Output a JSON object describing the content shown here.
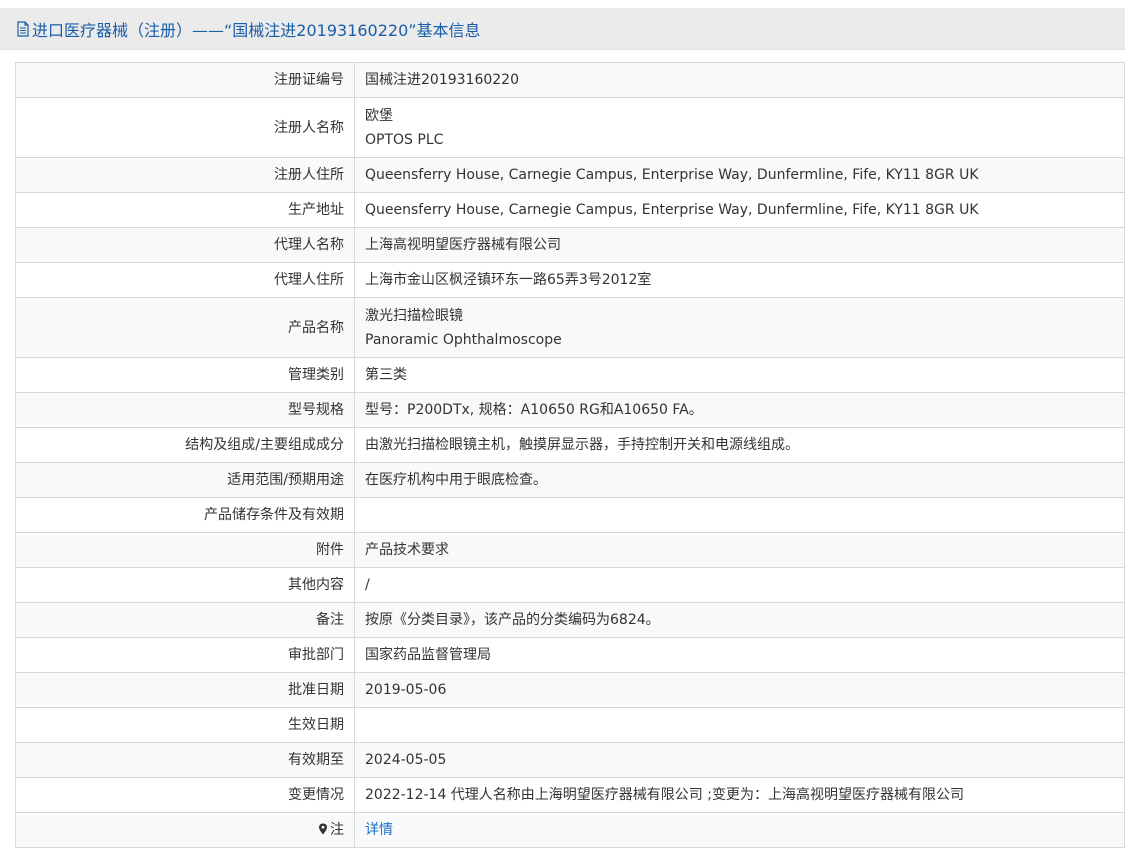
{
  "header": {
    "title": "进口医疗器械（注册）——“国械注进20193160220”基本信息"
  },
  "rows": [
    {
      "label": "注册证编号",
      "value": "国械注进20193160220"
    },
    {
      "label": "注册人名称",
      "value_line1": "欧堡",
      "value_line2": "OPTOS PLC"
    },
    {
      "label": "注册人住所",
      "value": "Queensferry House, Carnegie Campus, Enterprise Way, Dunfermline, Fife, KY11 8GR UK"
    },
    {
      "label": "生产地址",
      "value": "Queensferry House, Carnegie Campus, Enterprise Way, Dunfermline, Fife, KY11 8GR UK"
    },
    {
      "label": "代理人名称",
      "value": "上海高视明望医疗器械有限公司"
    },
    {
      "label": "代理人住所",
      "value": "上海市金山区枫泾镇环东一路65弄3号2012室"
    },
    {
      "label": "产品名称",
      "value_line1": "激光扫描检眼镜",
      "value_line2": "Panoramic Ophthalmoscope"
    },
    {
      "label": "管理类别",
      "value": "第三类"
    },
    {
      "label": "型号规格",
      "value": "型号：P200DTx, 规格：A10650 RG和A10650 FA。"
    },
    {
      "label": "结构及组成/主要组成成分",
      "value": "由激光扫描检眼镜主机，触摸屏显示器，手持控制开关和电源线组成。"
    },
    {
      "label": "适用范围/预期用途",
      "value": "在医疗机构中用于眼底检查。"
    },
    {
      "label": "产品储存条件及有效期",
      "value": ""
    },
    {
      "label": "附件",
      "value": "产品技术要求"
    },
    {
      "label": "其他内容",
      "value": "/"
    },
    {
      "label": "备注",
      "value": "按原《分类目录》，该产品的分类编码为6824。"
    },
    {
      "label": "审批部门",
      "value": "国家药品监督管理局"
    },
    {
      "label": "批准日期",
      "value": "2019-05-06"
    },
    {
      "label": "生效日期",
      "value": ""
    },
    {
      "label": "有效期至",
      "value": "2024-05-05"
    },
    {
      "label": "变更情况",
      "value": "2022-12-14 代理人名称由上海明望医疗器械有限公司 ;变更为：上海高视明望医疗器械有限公司"
    },
    {
      "label": "注",
      "value": "详情"
    }
  ],
  "icons": {
    "header": "document-icon",
    "note": "pin-icon"
  },
  "colors": {
    "title": "#1a5ea8",
    "link": "#1a6fc9",
    "header_bg": "#ebebeb",
    "border": "#d8d8d8",
    "row_alt": "#f7f9fa"
  }
}
